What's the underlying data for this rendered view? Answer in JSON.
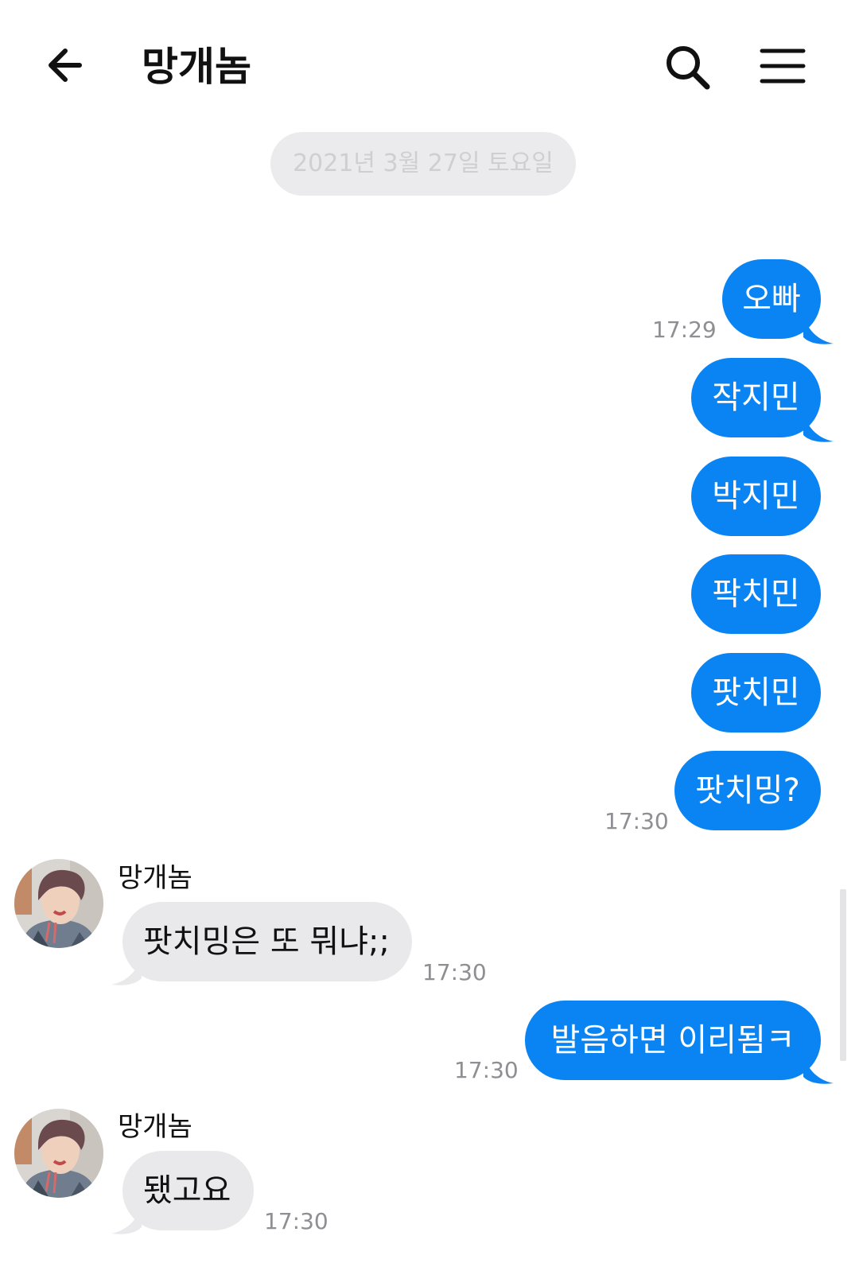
{
  "header": {
    "title": "망개놈",
    "back_icon": "arrow-left-icon",
    "search_icon": "search-icon",
    "menu_icon": "hamburger-menu-icon"
  },
  "date_divider": "2021년 3월 27일 토요일",
  "colors": {
    "outgoing_bubble": "#0a84f3",
    "incoming_bubble": "#e9e9eb",
    "timestamp": "#8e8e93"
  },
  "messages": [
    {
      "direction": "out",
      "text": "오빠",
      "time": "17:29"
    },
    {
      "direction": "out",
      "text": "작지민",
      "time": ""
    },
    {
      "direction": "out",
      "text": "박지민",
      "time": ""
    },
    {
      "direction": "out",
      "text": "팍치민",
      "time": ""
    },
    {
      "direction": "out",
      "text": "팟치민",
      "time": ""
    },
    {
      "direction": "out",
      "text": "팟치밍?",
      "time": "17:30"
    },
    {
      "direction": "in",
      "sender": "망개놈",
      "text": "팟치밍은 또 뭐냐;;",
      "time": "17:30"
    },
    {
      "direction": "out",
      "text": "발음하면 이리됨ㅋ",
      "time": "17:30"
    },
    {
      "direction": "in",
      "sender": "망개놈",
      "text": "됐고요",
      "time": "17:30"
    }
  ]
}
